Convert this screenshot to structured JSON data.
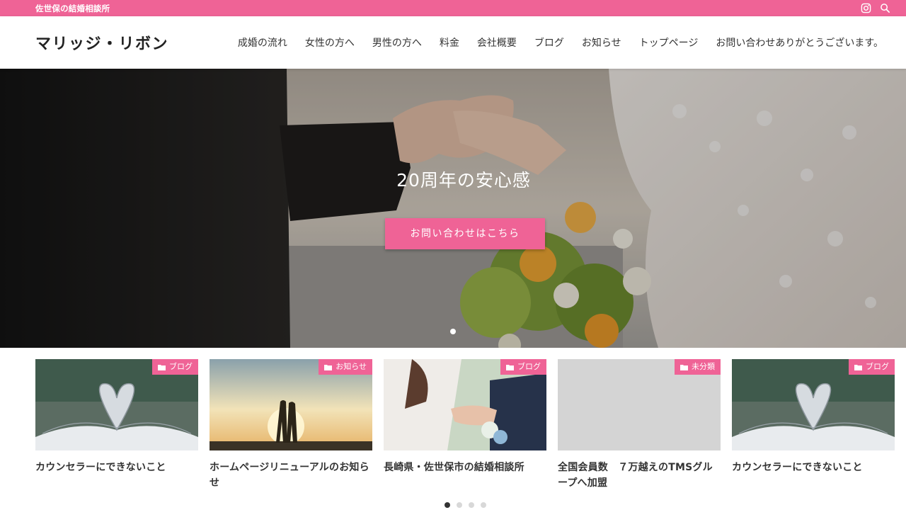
{
  "topbar": {
    "tagline": "佐世保の結婚相談所",
    "icons": [
      "instagram-icon",
      "search-icon"
    ],
    "color": "#ef6396"
  },
  "header": {
    "logo": "マリッジ・リボン",
    "nav": [
      "成婚の流れ",
      "女性の方へ",
      "男性の方へ",
      "料金",
      "会社概要",
      "ブログ",
      "お知らせ",
      "トップページ",
      "お問い合わせありがとうございます。"
    ]
  },
  "hero": {
    "title": "20周年の安心感",
    "button": "お問い合わせはこちら",
    "slides": 1,
    "active_slide": 1
  },
  "posts": [
    {
      "category": "ブログ",
      "title": "カウンセラーにできないこと",
      "thumb": "book-heart"
    },
    {
      "category": "お知らせ",
      "title": "ホームページリニューアルのお知らせ",
      "thumb": "sunset-couple"
    },
    {
      "category": "ブログ",
      "title": "長崎県・佐世保市の結婚相談所",
      "thumb": "wedding-rings"
    },
    {
      "category": "未分類",
      "title": "全国会員数　７万越えのTMSグループへ加盟",
      "thumb": "placeholder"
    },
    {
      "category": "ブログ",
      "title": "カウンセラーにできないこと",
      "thumb": "book-heart"
    }
  ],
  "pager": {
    "pages": 4,
    "active": 1
  },
  "colors": {
    "accent": "#ef6396",
    "text": "#333333"
  }
}
